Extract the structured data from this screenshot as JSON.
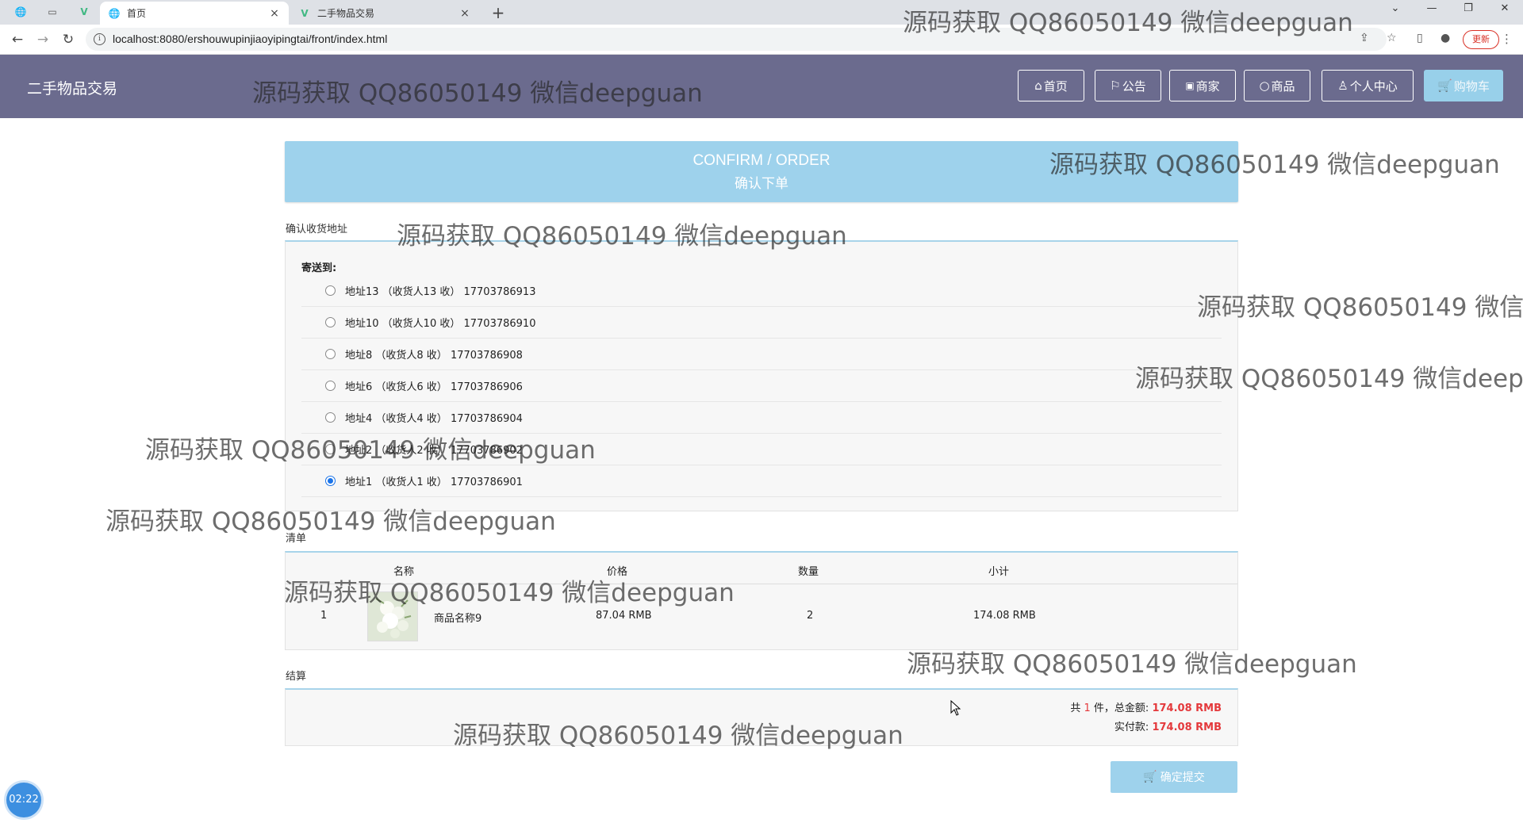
{
  "browser": {
    "tabs": [
      {
        "title": "首页",
        "icon": "globe-icon",
        "active": true
      },
      {
        "title": "二手物品交易",
        "icon": "vue-icon",
        "active": false
      }
    ],
    "close_glyph": "×",
    "new_tab_glyph": "+",
    "url": "localhost:8080/ershouwupinjiaoyipingtai/front/index.html",
    "update_label": "更新"
  },
  "site": {
    "title": "二手物品交易",
    "nav": [
      {
        "label": "首页",
        "icon": "home-icon"
      },
      {
        "label": "公告",
        "icon": "flag-icon"
      },
      {
        "label": "商家",
        "icon": "gift-icon"
      },
      {
        "label": "商品",
        "icon": "circle-icon"
      },
      {
        "label": "个人中心",
        "icon": "user-icon"
      },
      {
        "label": "购物车",
        "icon": "cart-icon"
      }
    ]
  },
  "banner": {
    "en": "CONFIRM / ORDER",
    "cn": "确认下单"
  },
  "address_section": {
    "label": "确认收货地址",
    "ship_to": "寄送到:",
    "addresses": [
      {
        "text": "地址13 （收货人13 收） 17703786913",
        "selected": false
      },
      {
        "text": "地址10 （收货人10 收） 17703786910",
        "selected": false
      },
      {
        "text": "地址8 （收货人8 收） 17703786908",
        "selected": false
      },
      {
        "text": "地址6 （收货人6 收） 17703786906",
        "selected": false
      },
      {
        "text": "地址4 （收货人4 收） 17703786904",
        "selected": false
      },
      {
        "text": "地址2 （收货人2 收） 17703786902",
        "selected": false
      },
      {
        "text": "地址1 （收货人1 收） 17703786901",
        "selected": true
      }
    ]
  },
  "list_section": {
    "label": "清单",
    "headers": {
      "name": "名称",
      "price": "价格",
      "qty": "数量",
      "subtotal": "小计"
    },
    "rows": [
      {
        "index": "1",
        "name": "商品名称9",
        "price": "87.04 RMB",
        "qty": "2",
        "subtotal": "174.08 RMB"
      }
    ]
  },
  "checkout_section": {
    "label": "结算",
    "count_prefix": "共",
    "count": "1",
    "count_suffix": "件，总金额:",
    "total": "174.08 RMB",
    "paid_label": "实付款:",
    "paid": "174.08 RMB"
  },
  "submit_label": "确定提交",
  "timer": "02:22",
  "watermark": "源码获取 QQ86050149 微信deepguan"
}
